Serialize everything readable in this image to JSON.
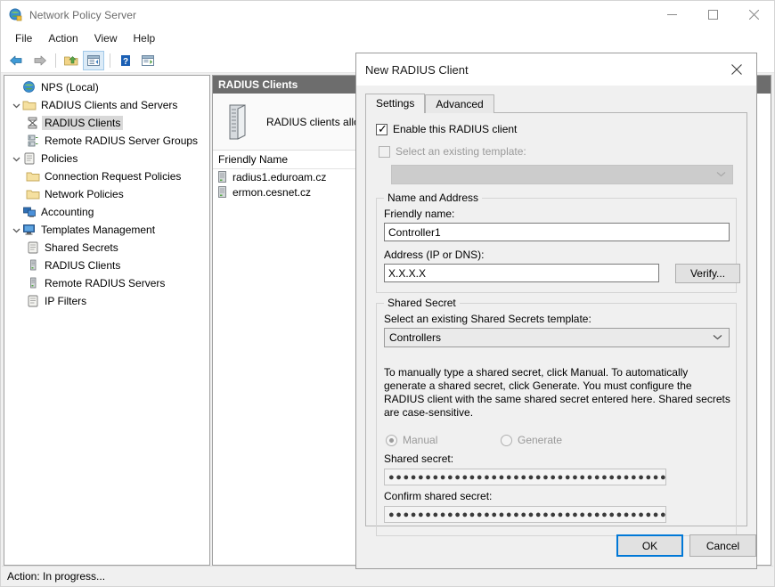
{
  "window": {
    "title": "Network Policy Server",
    "icon": "globe-network-icon",
    "minimize_label": "—",
    "maximize_label": "☐",
    "close_label": "✕"
  },
  "menubar": {
    "items": [
      {
        "label": "File"
      },
      {
        "label": "Action"
      },
      {
        "label": "View"
      },
      {
        "label": "Help"
      }
    ]
  },
  "toolbar": {
    "buttons": [
      {
        "name": "back-icon",
        "glyph": "←"
      },
      {
        "name": "forward-icon",
        "glyph": "→"
      },
      {
        "name": "up-folder-icon",
        "glyph": "↑"
      },
      {
        "name": "show-hide-console-tree-icon",
        "glyph": "▤"
      },
      {
        "name": "help-icon",
        "glyph": "?"
      },
      {
        "name": "show-hide-action-pane-icon",
        "glyph": "▥"
      }
    ]
  },
  "tree": {
    "nodes": [
      {
        "label": "NPS (Local)",
        "level": 1,
        "twist": "",
        "icon": "globe-network-icon",
        "selected": false
      },
      {
        "label": "RADIUS Clients and Servers",
        "level": 1,
        "twist": "∨",
        "icon": "folder-icon",
        "selected": false
      },
      {
        "label": "RADIUS Clients",
        "level": 2,
        "twist": "",
        "icon": "radius-clients-icon",
        "selected": true
      },
      {
        "label": "Remote RADIUS Server Groups",
        "level": 2,
        "twist": "",
        "icon": "server-group-icon",
        "selected": false
      },
      {
        "label": "Policies",
        "level": 1,
        "twist": "∨",
        "icon": "policy-scroll-icon",
        "selected": false
      },
      {
        "label": "Connection Request Policies",
        "level": 2,
        "twist": "",
        "icon": "folder-icon",
        "selected": false
      },
      {
        "label": "Network Policies",
        "level": 2,
        "twist": "",
        "icon": "folder-icon",
        "selected": false
      },
      {
        "label": "Accounting",
        "level": 1,
        "twist": "",
        "icon": "accounting-monitor-icon",
        "selected": false
      },
      {
        "label": "Templates Management",
        "level": 1,
        "twist": "∨",
        "icon": "templates-monitor-icon",
        "selected": false
      },
      {
        "label": "Shared Secrets",
        "level": 2,
        "twist": "",
        "icon": "policy-scroll-icon",
        "selected": false
      },
      {
        "label": "RADIUS Clients",
        "level": 2,
        "twist": "",
        "icon": "server-small-icon",
        "selected": false
      },
      {
        "label": "Remote RADIUS Servers",
        "level": 2,
        "twist": "",
        "icon": "server-small-icon",
        "selected": false
      },
      {
        "label": "IP Filters",
        "level": 2,
        "twist": "",
        "icon": "policy-scroll-icon",
        "selected": false
      }
    ]
  },
  "list_pane": {
    "header": "RADIUS Clients",
    "description": "RADIUS clients allow yo",
    "description_icon": "server-icon",
    "column_header": "Friendly Name",
    "rows": [
      {
        "name": "radius1.eduroam.cz",
        "icon": "server-small-icon"
      },
      {
        "name": "ermon.cesnet.cz",
        "icon": "server-small-icon"
      }
    ]
  },
  "statusbar": {
    "text": "Action:  In progress..."
  },
  "dialog": {
    "title": "New RADIUS Client",
    "close_label": "✕",
    "tabs": [
      {
        "label": "Settings",
        "active": true
      },
      {
        "label": "Advanced",
        "active": false
      }
    ],
    "enable_client": {
      "label": "Enable this RADIUS client",
      "checked": true
    },
    "select_template": {
      "label": "Select an existing template:",
      "checked": false,
      "disabled": true,
      "value": "",
      "arrow": "⌄"
    },
    "name_and_address": {
      "legend": "Name and Address",
      "friendly_name_label": "Friendly name:",
      "friendly_name_value": "Controller1",
      "address_label": "Address (IP or DNS):",
      "address_value": "X.X.X.X",
      "verify_button": "Verify..."
    },
    "shared_secret": {
      "legend": "Shared Secret",
      "template_label": "Select an existing Shared Secrets template:",
      "template_value": "Controllers",
      "template_arrow": "⌄",
      "help_text": "To manually type a shared secret, click Manual. To automatically generate a shared secret, click Generate. You must configure the RADIUS client with the same shared secret entered here. Shared secrets are case-sensitive.",
      "manual_label": "Manual",
      "manual_selected": true,
      "generate_label": "Generate",
      "generate_selected": false,
      "secret_label": "Shared secret:",
      "secret_value": "●●●●●●●●●●●●●●●●●●●●●●●●●●●●●●●●●●●●●●●●●●●●●",
      "confirm_label": "Confirm shared secret:",
      "confirm_value": "●●●●●●●●●●●●●●●●●●●●●●●●●●●●●●●●●●●●●●●●●●●●●"
    },
    "ok_button": "OK",
    "cancel_button": "Cancel"
  },
  "colors": {
    "accent": "#0078d7",
    "header_gray": "#6d6d6d",
    "dialog_bg": "#f0f0f0",
    "selection_gray": "#d8d8d8"
  }
}
